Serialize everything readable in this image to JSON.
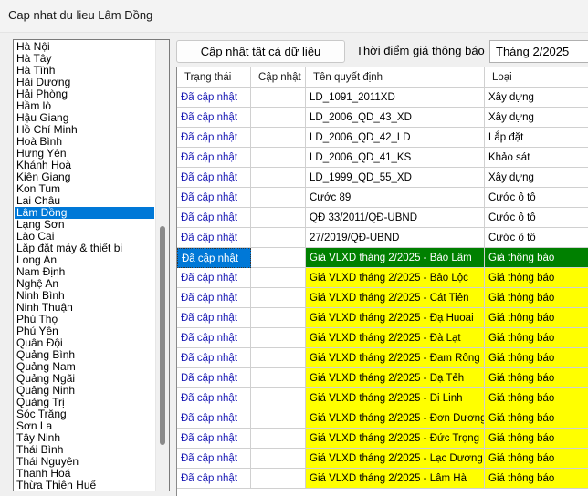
{
  "window": {
    "title": "Cap nhat du lieu Lâm Đồng"
  },
  "provinces": {
    "items": [
      "Hà Nội",
      "Hà Tây",
      "Hà Tĩnh",
      "Hải Dương",
      "Hải Phòng",
      "Hầm lò",
      "Hậu Giang",
      "Hồ Chí Minh",
      "Hoà Bình",
      "Hưng Yên",
      "Khánh Hoà",
      "Kiên Giang",
      "Kon Tum",
      "Lai Châu",
      "Lâm Đồng",
      "Lạng Sơn",
      "Lào Cai",
      "Lắp đặt máy & thiết bị",
      "Long An",
      "Nam Định",
      "Nghệ An",
      "Ninh Bình",
      "Ninh Thuận",
      "Phú Thọ",
      "Phú Yên",
      "Quân Đội",
      "Quảng Bình",
      "Quảng Nam",
      "Quảng Ngãi",
      "Quảng Ninh",
      "Quảng Trị",
      "Sóc Trăng",
      "Sơn La",
      "Tây Ninh",
      "Thái Bình",
      "Thái Nguyên",
      "Thanh Hoá",
      "Thừa Thiên Huế"
    ],
    "selected": "Lâm Đồng"
  },
  "toolbar": {
    "update_all_label": "Cập nhật tất cả dữ liệu",
    "time_label": "Thời điểm giá thông báo",
    "time_value": "Tháng 2/2025"
  },
  "grid": {
    "headers": {
      "status": "Trạng thái",
      "update": "Cập nhật",
      "name": "Tên quyết định",
      "type": "Loại"
    },
    "rows": [
      {
        "status": "Đã cập nhật",
        "update": "",
        "name": "LD_1091_2011XD",
        "type": "Xây dựng",
        "highlight": "none"
      },
      {
        "status": "Đã cập nhật",
        "update": "",
        "name": "LD_2006_QD_43_XD",
        "type": "Xây dựng",
        "highlight": "none"
      },
      {
        "status": "Đã cập nhật",
        "update": "",
        "name": "LD_2006_QD_42_LD",
        "type": "Lắp đặt",
        "highlight": "none"
      },
      {
        "status": "Đã cập nhật",
        "update": "",
        "name": "LD_2006_QD_41_KS",
        "type": "Khảo sát",
        "highlight": "none"
      },
      {
        "status": "Đã cập nhật",
        "update": "",
        "name": "LD_1999_QD_55_XD",
        "type": "Xây dựng",
        "highlight": "none"
      },
      {
        "status": "Đã cập nhật",
        "update": "",
        "name": "Cước 89",
        "type": "Cước ô tô",
        "highlight": "none"
      },
      {
        "status": "Đã cập nhật",
        "update": "",
        "name": "QĐ 33/2011/QĐ-UBND",
        "type": "Cước ô tô",
        "highlight": "none"
      },
      {
        "status": "Đã cập nhật",
        "update": "",
        "name": "27/2019/QĐ-UBND",
        "type": "Cước ô tô",
        "highlight": "none"
      },
      {
        "status": "Đã cập nhật",
        "update": "",
        "name": "Giá VLXD tháng 2/2025 - Bảo Lâm",
        "type": "Giá thông báo",
        "highlight": "green",
        "selected": true
      },
      {
        "status": "Đã cập nhật",
        "update": "",
        "name": "Giá VLXD tháng 2/2025 - Bảo Lộc",
        "type": "Giá thông báo",
        "highlight": "yellow"
      },
      {
        "status": "Đã cập nhật",
        "update": "",
        "name": "Giá VLXD tháng 2/2025 - Cát Tiên",
        "type": "Giá thông báo",
        "highlight": "yellow"
      },
      {
        "status": "Đã cập nhật",
        "update": "",
        "name": "Giá VLXD tháng 2/2025 - Đạ Huoai",
        "type": "Giá thông báo",
        "highlight": "yellow"
      },
      {
        "status": "Đã cập nhật",
        "update": "",
        "name": "Giá VLXD tháng 2/2025 - Đà Lạt",
        "type": "Giá thông báo",
        "highlight": "yellow"
      },
      {
        "status": "Đã cập nhật",
        "update": "",
        "name": "Giá VLXD tháng 2/2025 - Đam Rông",
        "type": "Giá thông báo",
        "highlight": "yellow"
      },
      {
        "status": "Đã cập nhật",
        "update": "",
        "name": "Giá VLXD tháng 2/2025 - Đạ Tẻh",
        "type": "Giá thông báo",
        "highlight": "yellow"
      },
      {
        "status": "Đã cập nhật",
        "update": "",
        "name": "Giá VLXD tháng 2/2025 - Di Linh",
        "type": "Giá thông báo",
        "highlight": "yellow"
      },
      {
        "status": "Đã cập nhật",
        "update": "",
        "name": "Giá VLXD tháng 2/2025 - Đơn Dương",
        "type": "Giá thông báo",
        "highlight": "yellow"
      },
      {
        "status": "Đã cập nhật",
        "update": "",
        "name": "Giá VLXD tháng 2/2025 - Đức Trọng",
        "type": "Giá thông báo",
        "highlight": "yellow"
      },
      {
        "status": "Đã cập nhật",
        "update": "",
        "name": "Giá VLXD tháng 2/2025 - Lạc Dương",
        "type": "Giá thông báo",
        "highlight": "yellow"
      },
      {
        "status": "Đã cập nhật",
        "update": "",
        "name": "Giá VLXD tháng 2/2025 - Lâm Hà",
        "type": "Giá thông báo",
        "highlight": "yellow"
      }
    ]
  },
  "colors": {
    "selection": "#0078d7",
    "green_row": "#008000",
    "yellow_row": "#ffff00",
    "status_text": "#1a1ab4"
  }
}
